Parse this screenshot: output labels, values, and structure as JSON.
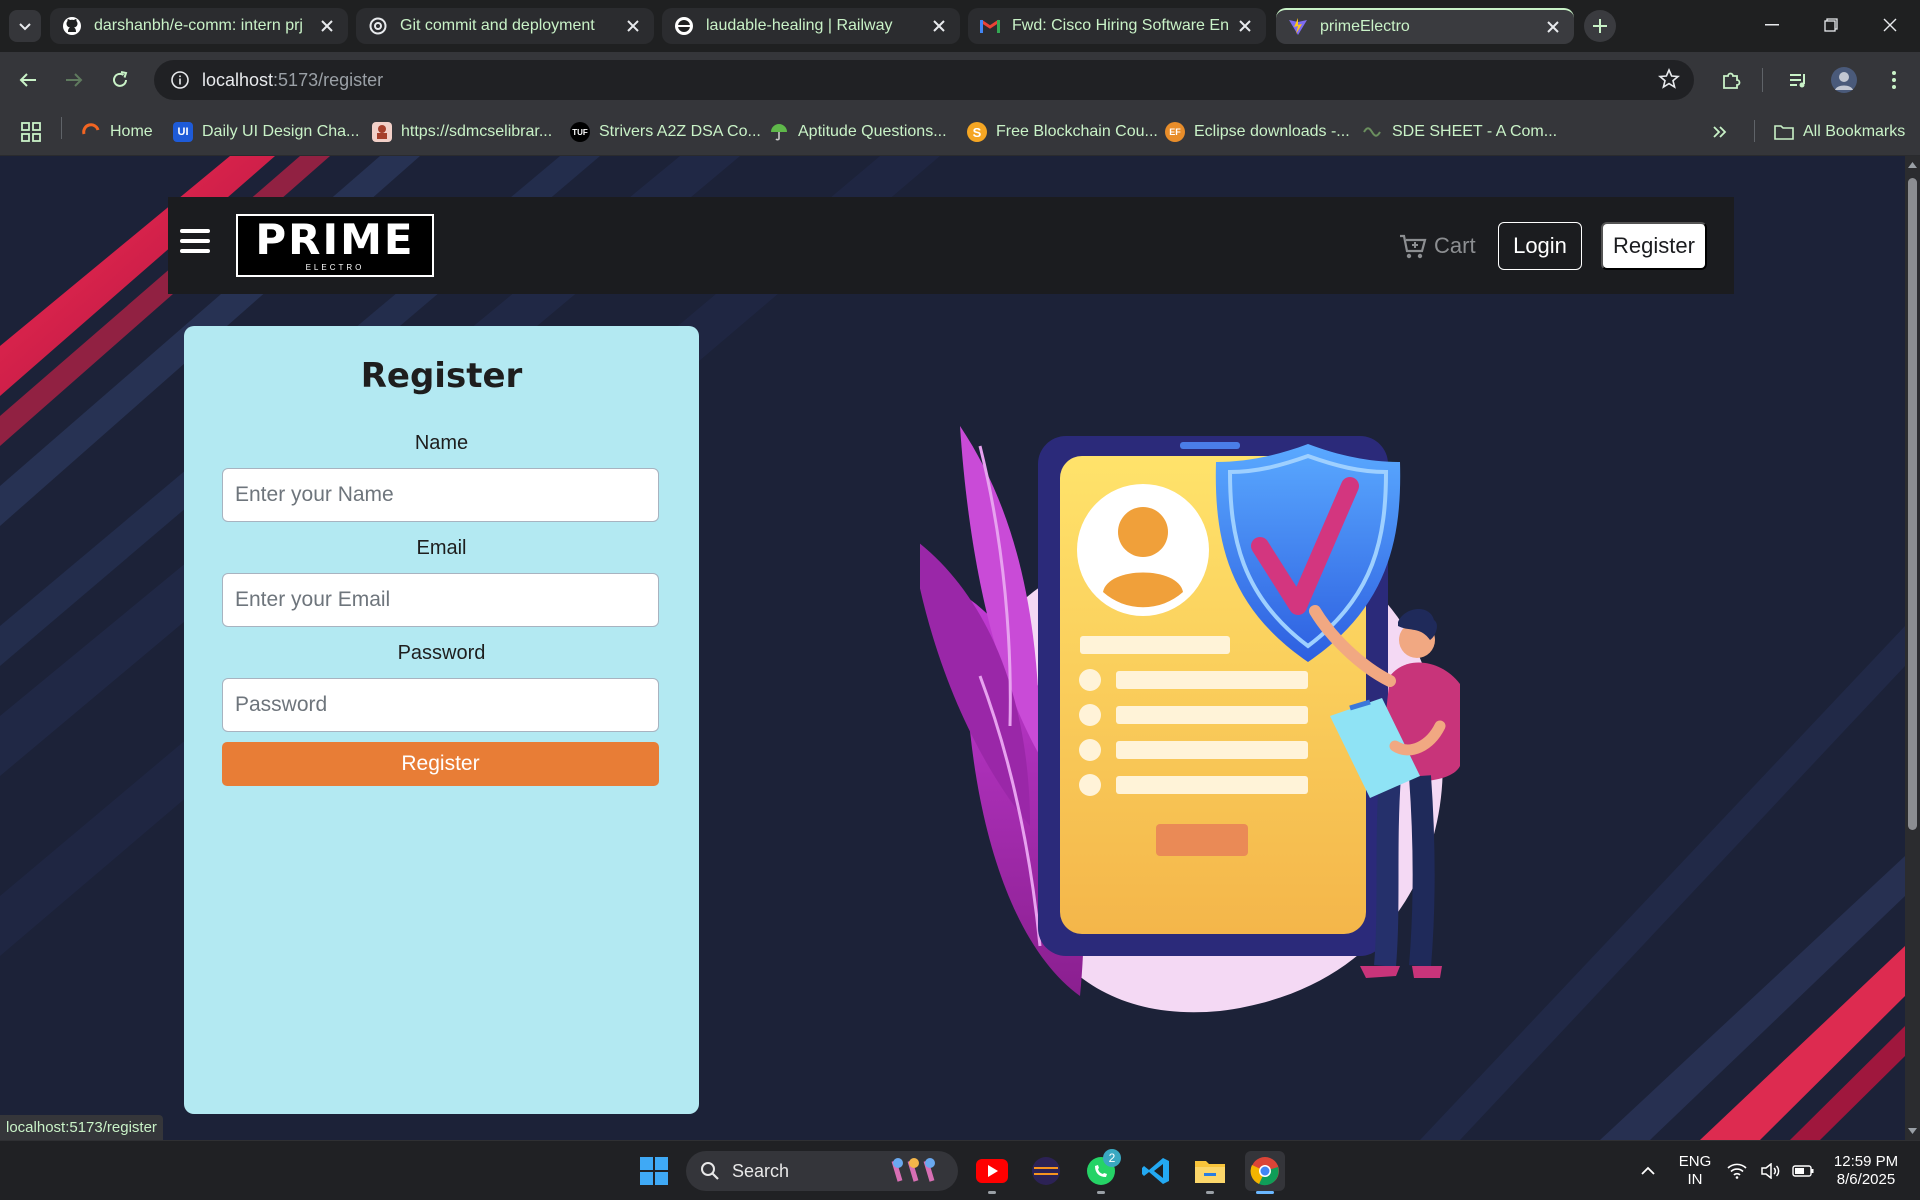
{
  "browser": {
    "tabs": [
      {
        "title": "darshanbh/e-comm: intern prj",
        "favicon": "github-icon"
      },
      {
        "title": "Git commit and deployment",
        "favicon": "openai-icon"
      },
      {
        "title": "laudable-healing | Railway",
        "favicon": "railway-icon"
      },
      {
        "title": "Fwd: Cisco Hiring Software Eng",
        "favicon": "gmail-icon"
      },
      {
        "title": "primeElectro",
        "favicon": "vite-icon",
        "active": true
      }
    ],
    "address": {
      "host": "localhost",
      "path": ":5173/register"
    },
    "bookmarks": [
      {
        "label": "Home",
        "icon": "home-ring-icon"
      },
      {
        "label": "Daily UI Design Cha...",
        "icon": "ui-icon"
      },
      {
        "label": "https://sdmcselibrar...",
        "icon": "library-icon"
      },
      {
        "label": "Strivers A2Z DSA Co...",
        "icon": "tuf-icon"
      },
      {
        "label": "Aptitude Questions...",
        "icon": "umbrella-icon"
      },
      {
        "label": "Free Blockchain Cou...",
        "icon": "s-coin-icon"
      },
      {
        "label": "Eclipse downloads -...",
        "icon": "eclipse-icon"
      },
      {
        "label": "SDE SHEET - A Com...",
        "icon": "sheet-icon"
      }
    ],
    "all_bookmarks": "All Bookmarks",
    "status_url": "localhost:5173/register"
  },
  "site": {
    "logo_main": "PRIME",
    "logo_sub": "ELECTRO",
    "cart_label": "Cart",
    "login_label": "Login",
    "register_label": "Register"
  },
  "form": {
    "title": "Register",
    "name_label": "Name",
    "name_placeholder": "Enter your Name",
    "email_label": "Email",
    "email_placeholder": "Enter your Email",
    "password_label": "Password",
    "password_placeholder": "Password",
    "submit_label": "Register"
  },
  "taskbar": {
    "search_label": "Search",
    "lang_top": "ENG",
    "lang_bottom": "IN",
    "time": "12:59 PM",
    "date": "8/6/2025",
    "whatsapp_badge": "2"
  },
  "colors": {
    "card_bg": "#b3e9f2",
    "submit_bg": "#e87d36",
    "page_bg": "#1c2238",
    "tab_text": "#c9f2c7"
  }
}
